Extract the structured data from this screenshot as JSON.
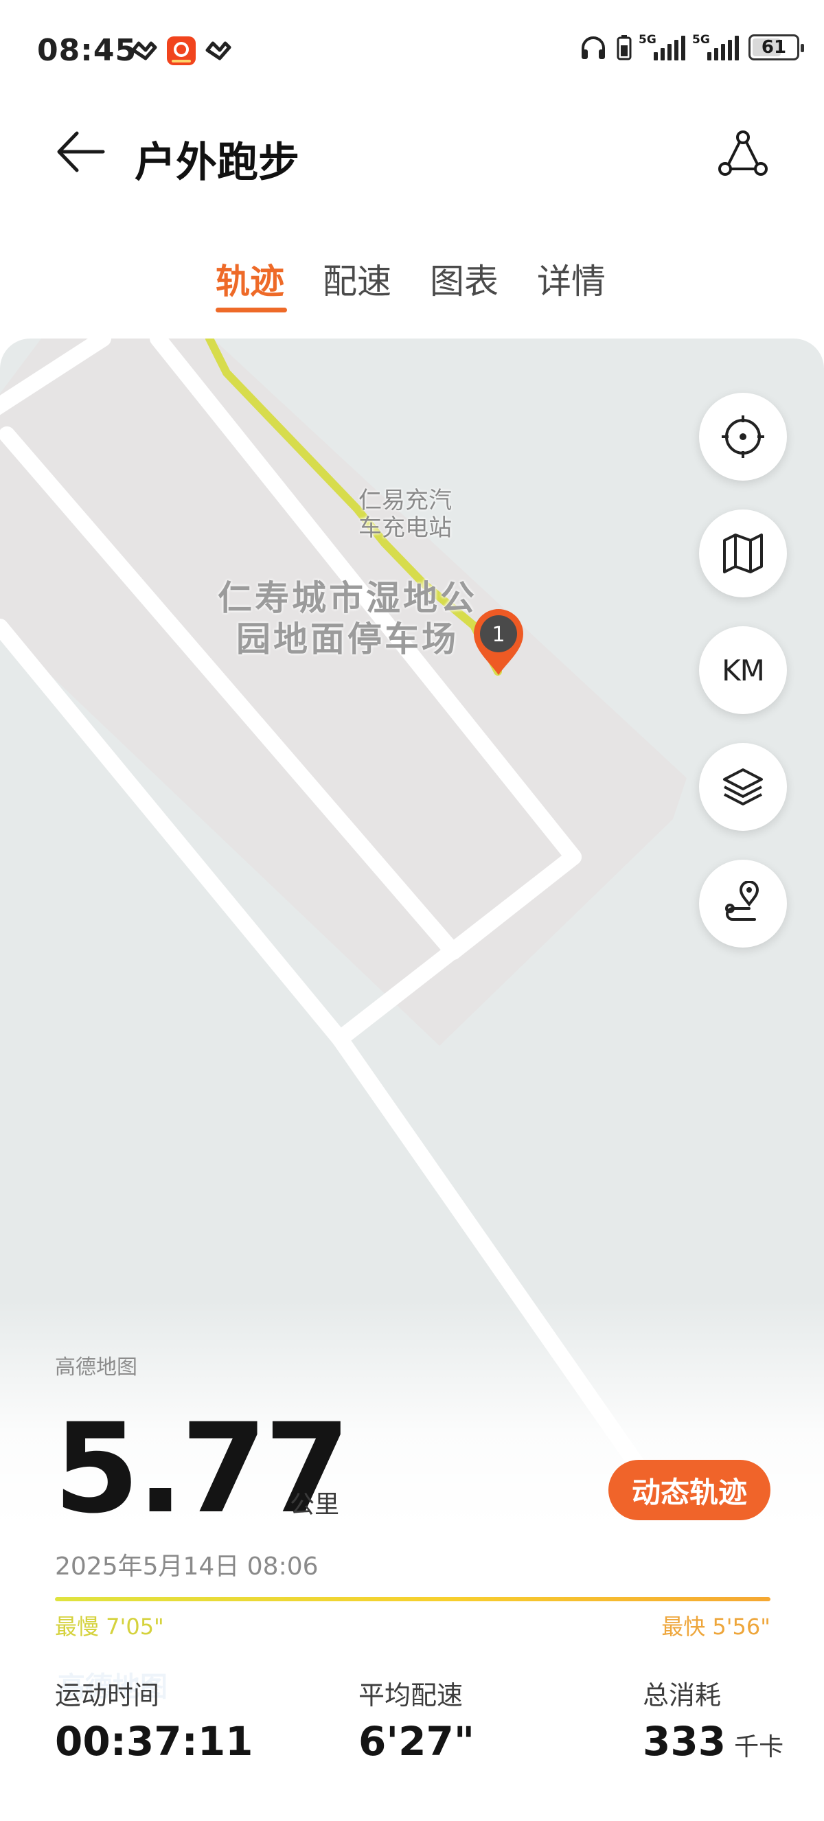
{
  "status_bar": {
    "time": "08:45",
    "network_1": "5G",
    "network_2": "5G",
    "battery": "61"
  },
  "header": {
    "title": "户外跑步"
  },
  "tabs": [
    "轨迹",
    "配速",
    "图表",
    "详情"
  ],
  "active_tab": 0,
  "map": {
    "poi_small_line1": "仁易充汽",
    "poi_small_line2": "车充电站",
    "poi_big_line1": "仁寿城市湿地公",
    "poi_big_line2": "园地面停车场",
    "marker_label": "1",
    "provider": "高德地图",
    "watermark": "高德地图",
    "route_color": "#d7dc4c",
    "marker_color": "#ee5a24",
    "controls": [
      "locate-icon",
      "map-icon",
      "KM",
      "layers-icon",
      "route-pin-icon"
    ],
    "km_label": "KM"
  },
  "summary": {
    "distance": "5.77",
    "distance_unit": "公里",
    "dynamic_track_button": "动态轨迹",
    "date": "2025年5月14日 08:06",
    "slowest_label": "最慢 7'05\"",
    "fastest_label": "最快 5'56\"",
    "accent_color": "#f0642a"
  },
  "stats": [
    {
      "label": "运动时间",
      "value": "00:37:11",
      "unit": ""
    },
    {
      "label": "平均配速",
      "value": "6'27\"",
      "unit": ""
    },
    {
      "label": "总消耗",
      "value": "333",
      "unit": "千卡"
    }
  ]
}
